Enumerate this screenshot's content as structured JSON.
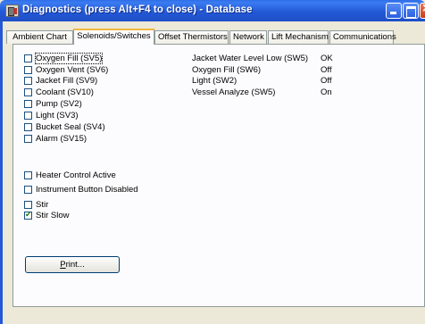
{
  "window": {
    "title": "Diagnostics  (press Alt+F4 to close) - Database"
  },
  "tabs": [
    {
      "label": "Ambient Chart",
      "active": false
    },
    {
      "label": "Solenoids/Switches",
      "active": true
    },
    {
      "label": "Offset Thermistors",
      "active": false
    },
    {
      "label": "Network",
      "active": false
    },
    {
      "label": "Lift Mechanism",
      "active": false
    },
    {
      "label": "Communications",
      "active": false
    }
  ],
  "solenoids": [
    {
      "label": "Oxygen Fill (SV5)",
      "checked": false
    },
    {
      "label": "Oxygen Vent (SV6)",
      "checked": false
    },
    {
      "label": "Jacket Fill (SV9)",
      "checked": false
    },
    {
      "label": "Coolant (SV10)",
      "checked": false
    },
    {
      "label": "Pump (SV2)",
      "checked": false
    },
    {
      "label": "Light (SV3)",
      "checked": false
    },
    {
      "label": "Bucket Seal (SV4)",
      "checked": false
    },
    {
      "label": "Alarm (SV15)",
      "checked": false
    }
  ],
  "options": [
    {
      "label": "Heater Control Active",
      "checked": false
    },
    {
      "label": "Instrument Button Disabled",
      "checked": false
    }
  ],
  "stir": [
    {
      "label": "Stir",
      "checked": false
    },
    {
      "label": "Stir Slow",
      "checked": true
    }
  ],
  "switches": [
    {
      "label": "Jacket Water Level Low (SW5)",
      "value": "OK"
    },
    {
      "label": "Oxygen Fill (SW6)",
      "value": "Off"
    },
    {
      "label": "Light (SW2)",
      "value": "Off"
    },
    {
      "label": "Vessel Analyze (SW5)",
      "value": "On"
    }
  ],
  "print_button": {
    "mnemonic": "P",
    "rest": "rint..."
  }
}
